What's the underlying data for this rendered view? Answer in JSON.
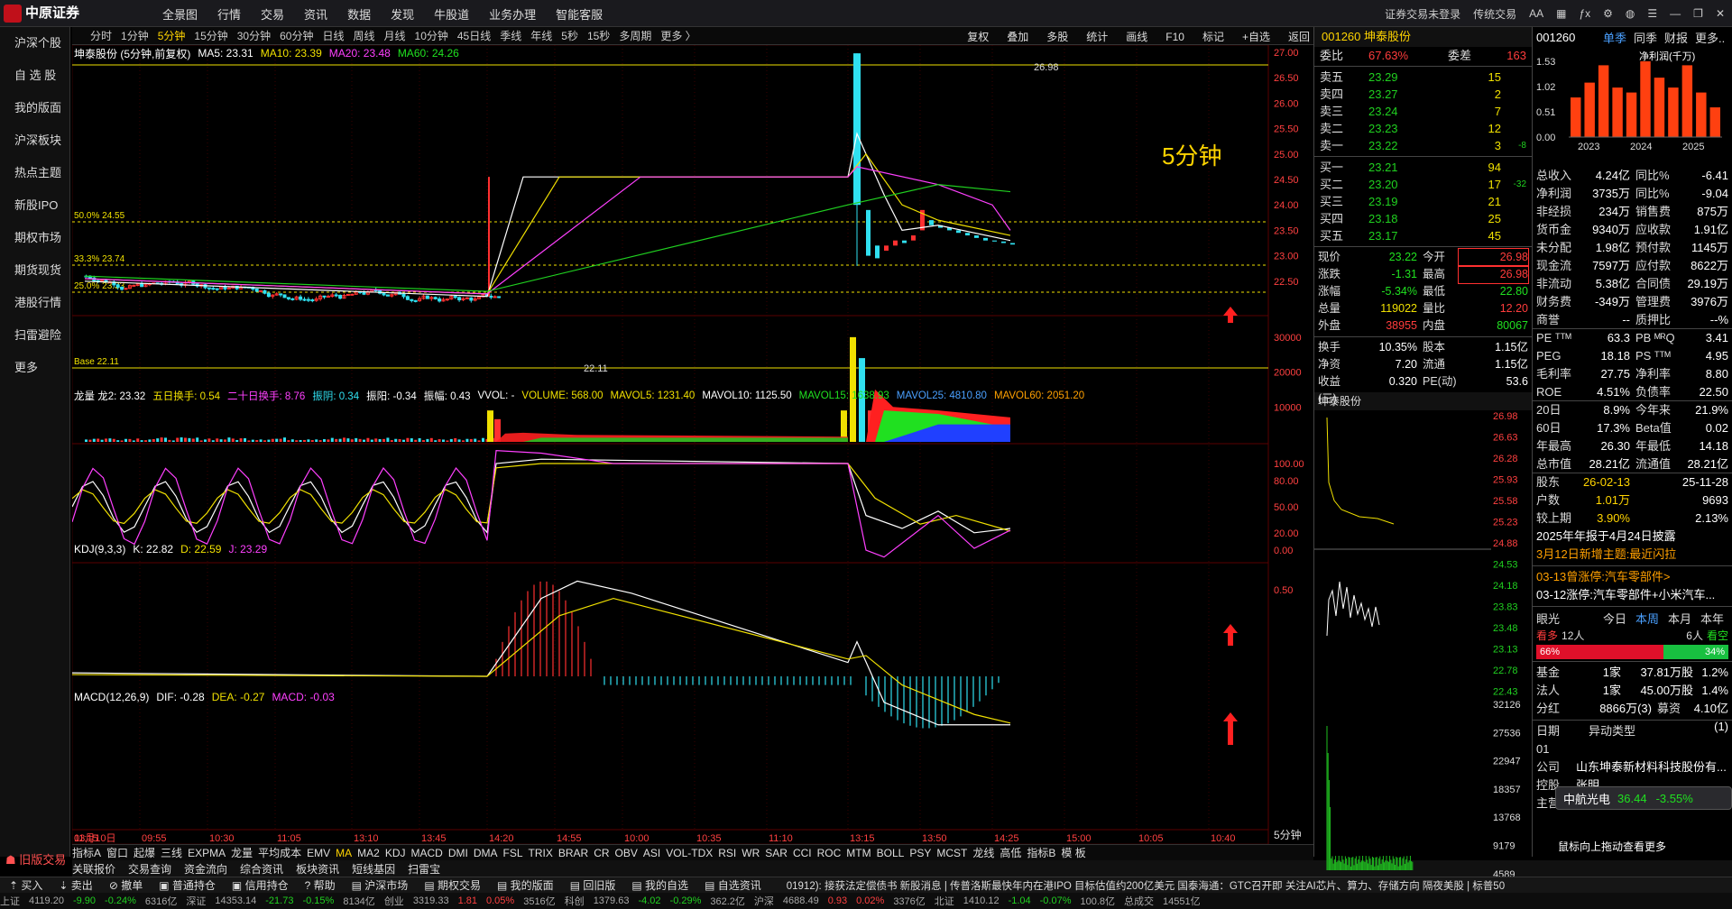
{
  "app": {
    "brand": "中原证券",
    "brand_sub": "CENTRAL CHINA SECURITIES"
  },
  "topmenu": [
    "全景图",
    "行情",
    "交易",
    "资讯",
    "数据",
    "发现",
    "牛股道",
    "业务办理",
    "智能客服"
  ],
  "topright": [
    "证券交易未登录",
    "传统交易"
  ],
  "leftnav": [
    "沪深个股",
    "自 选 股",
    "我的版面",
    "沪深板块",
    "热点主题",
    "新股IPO",
    "期权市场",
    "期货现货",
    "港股行情",
    "扫雷避险",
    "更多"
  ],
  "legacy": "旧版交易",
  "periods": [
    "分时",
    "1分钟",
    "5分钟",
    "15分钟",
    "30分钟",
    "60分钟",
    "日线",
    "周线",
    "月线",
    "10分钟",
    "45日线",
    "季线",
    "年线",
    "5秒",
    "15秒",
    "多周期",
    "更多 〉"
  ],
  "tools": [
    "复权",
    "叠加",
    "多股",
    "统计",
    "画线",
    "F10",
    "标记",
    "+自选",
    "返回"
  ],
  "chart": {
    "title": "坤泰股份 (5分钟,前复权)",
    "ma": [
      {
        "label": "MA5: 23.31",
        "color": "#ffffff"
      },
      {
        "label": "MA10: 23.39",
        "color": "#f0e000"
      },
      {
        "label": "MA20: 23.48",
        "color": "#ff40ff"
      },
      {
        "label": "MA60: 24.26",
        "color": "#20d020"
      }
    ],
    "big_label": "5分钟",
    "fib": [
      "50.0% 24.55",
      "33.3% 23.74",
      "25.0% 23.33",
      "Base 22.11"
    ],
    "high_mark": "26.98",
    "low_mark": "22.11",
    "price_axis": [
      "27.00",
      "26.50",
      "26.00",
      "25.50",
      "25.00",
      "24.50",
      "24.00",
      "23.50",
      "23.00",
      "22.50"
    ],
    "vol_legend": [
      "龙量 龙2: 23.32",
      "五日换手: 0.54",
      "二十日换手: 8.76",
      "振阴: 0.34",
      "振阳: -0.34",
      "振幅: 0.43",
      "VVOL: -",
      "VOLUME: 568.00",
      "MAVOL5: 1231.40",
      "MAVOL10: 1125.50",
      "MAVOL15: 1638.93",
      "MAVOL25: 4810.80",
      "MAVOL60: 2051.20"
    ],
    "vol_axis": [
      "30000",
      "20000",
      "10000"
    ],
    "kdj_legend": [
      "KDJ(9,3,3)",
      "K: 22.82",
      "D: 22.59",
      "J: 23.29"
    ],
    "kdj_axis": [
      "100.00",
      "80.00",
      "50.00",
      "20.00",
      "0.00"
    ],
    "macd_legend": [
      "MACD(12,26,9)",
      "DIF: -0.28",
      "DEA: -0.27",
      "MACD: -0.03"
    ],
    "macd_axis": [
      "0.50"
    ],
    "time_axis": [
      "03月10日",
      "09:55",
      "10:30",
      "11:05",
      "13:10",
      "13:45",
      "14:20",
      "14:55",
      "10:00",
      "10:35",
      "11:10",
      "13:15",
      "13:50",
      "14:25",
      "15:00",
      "10:05",
      "10:40",
      "11:15"
    ],
    "period_tag": "5分钟"
  },
  "bottomtabs": [
    "指标A",
    "窗口",
    "起爆",
    "三线",
    "EXPMA",
    "龙量",
    "平均成本",
    "EMV",
    "MA",
    "MA2",
    "KDJ",
    "MACD",
    "DMI",
    "DMA",
    "FSL",
    "TRIX",
    "BRAR",
    "CR",
    "OBV",
    "ASI",
    "VOL-TDX",
    "RSI",
    "WR",
    "SAR",
    "CCI",
    "ROC",
    "MTM",
    "BOLL",
    "PSY",
    "MCST",
    "龙线",
    "高低",
    "指标B",
    "模 板"
  ],
  "funcbar": [
    "关联报价",
    "交易查询",
    "资金流向",
    "综合资讯",
    "板块资讯",
    "短线基因",
    "扫雷宝"
  ],
  "quote": {
    "title": "001260 坤泰股份",
    "weibi": {
      "label": "委比",
      "val": "67.63%",
      "label2": "委差",
      "val2": "163"
    },
    "sells": [
      {
        "l": "卖五",
        "p": "23.29",
        "v": "15"
      },
      {
        "l": "卖四",
        "p": "23.27",
        "v": "2"
      },
      {
        "l": "卖三",
        "p": "23.24",
        "v": "7"
      },
      {
        "l": "卖二",
        "p": "23.23",
        "v": "12"
      },
      {
        "l": "卖一",
        "p": "23.22",
        "v": "3",
        "x": "-8"
      }
    ],
    "buys": [
      {
        "l": "买一",
        "p": "23.21",
        "v": "94"
      },
      {
        "l": "买二",
        "p": "23.20",
        "v": "17",
        "x": "-32"
      },
      {
        "l": "买三",
        "p": "23.19",
        "v": "21"
      },
      {
        "l": "买四",
        "p": "23.18",
        "v": "25"
      },
      {
        "l": "买五",
        "p": "23.17",
        "v": "45"
      }
    ],
    "stats": [
      {
        "a": "现价",
        "b": "23.22",
        "bc": "grn",
        "c": "今开",
        "d": "26.98",
        "dc": "red"
      },
      {
        "a": "涨跌",
        "b": "-1.31",
        "bc": "grn",
        "c": "最高",
        "d": "26.98",
        "dc": "red"
      },
      {
        "a": "涨幅",
        "b": "-5.34%",
        "bc": "grn",
        "c": "最低",
        "d": "22.80",
        "dc": "grn"
      },
      {
        "a": "总量",
        "b": "119022",
        "bc": "yel",
        "c": "量比",
        "d": "12.20",
        "dc": "red"
      },
      {
        "a": "外盘",
        "b": "38955",
        "bc": "red",
        "c": "内盘",
        "d": "80067",
        "dc": "grn"
      }
    ],
    "stats2": [
      {
        "a": "换手",
        "b": "10.35%",
        "c": "股本",
        "d": "1.15亿"
      },
      {
        "a": "净资",
        "b": "7.20",
        "c": "流通",
        "d": "1.15亿"
      },
      {
        "a": "收益(三)",
        "b": "0.320",
        "c": "PE(动)",
        "d": "53.6"
      }
    ],
    "mini_title": "坤泰股份",
    "mini_axis": [
      "26.98",
      "26.63",
      "26.28",
      "25.93",
      "25.58",
      "25.23",
      "24.88",
      "24.53",
      "24.18",
      "23.83",
      "23.48",
      "23.13",
      "22.78",
      "22.43",
      "32126",
      "27536",
      "22947",
      "18357",
      "13768",
      "9179",
      "4589"
    ]
  },
  "fin": {
    "code": "001260",
    "tabs": [
      "单季",
      "同季",
      "财报",
      "更多.."
    ],
    "chart_title": "净利润(千万)",
    "yaxis": [
      "1.53",
      "1.02",
      "0.51",
      "0.00"
    ],
    "years": [
      "2023",
      "2024",
      "2025"
    ],
    "bars": [
      0.8,
      1.1,
      1.45,
      1.0,
      0.9,
      1.53,
      1.2,
      1.0,
      1.45,
      0.9,
      0.6
    ],
    "rows": [
      {
        "a": "总收入",
        "b": "4.24亿",
        "c": "同比%",
        "d": "-6.41"
      },
      {
        "a": "净利润",
        "b": "3735万",
        "c": "同比%",
        "d": "-9.04"
      },
      {
        "a": "非经损",
        "b": "234万",
        "c": "销售费",
        "d": "875万"
      },
      {
        "a": "货币金",
        "b": "9340万",
        "c": "应收款",
        "d": "1.91亿"
      },
      {
        "a": "未分配",
        "b": "1.98亿",
        "c": "预付款",
        "d": "1145万"
      },
      {
        "a": "现金流",
        "b": "7597万",
        "c": "应付款",
        "d": "8622万"
      },
      {
        "a": "非流动",
        "b": "5.38亿",
        "c": "合同债",
        "d": "29.19万"
      },
      {
        "a": "财务费",
        "b": "-349万",
        "c": "管理费",
        "d": "3976万"
      },
      {
        "a": "商誉",
        "b": "--",
        "c": "质押比",
        "d": "--%"
      },
      {
        "a": "PE ᵀᵀᴹ",
        "b": "63.3",
        "c": "PB ᴹᴿQ",
        "d": "3.41"
      },
      {
        "a": "PEG",
        "b": "18.18",
        "c": "PS ᵀᵀᴹ",
        "d": "4.95"
      },
      {
        "a": "毛利率",
        "b": "27.75",
        "c": "净利率",
        "d": "8.80"
      },
      {
        "a": "ROE",
        "b": "4.51%",
        "c": "负债率",
        "d": "22.50"
      },
      {
        "a": "20日",
        "b": "8.9%",
        "c": "今年来",
        "d": "21.9%"
      },
      {
        "a": "60日",
        "b": "17.3%",
        "c": "Beta值",
        "d": "0.02"
      },
      {
        "a": "年最高",
        "b": "26.30",
        "c": "年最低",
        "d": "14.18"
      },
      {
        "a": "总市值",
        "b": "28.21亿",
        "c": "流通值",
        "d": "28.21亿"
      },
      {
        "a": "股东",
        "b": "26-02-13",
        "c": "",
        "d": "25-11-28"
      },
      {
        "a": "户数",
        "b": "1.01万",
        "c": "",
        "d": "9693"
      },
      {
        "a": "较上期",
        "b": "3.90%",
        "c": "",
        "d": "2.13%"
      }
    ],
    "notice1": "2025年年报于4月24日披露",
    "notice2": "3月12日新增主题:最近闪拉",
    "news1": "03-13曾涨停:汽车零部件>",
    "news2": "03-12涨停:汽车零部件+小米汽车...",
    "view": {
      "label": "眼光",
      "tabs": [
        "今日",
        "本周",
        "本月",
        "本年"
      ],
      "bull": "看多",
      "bull_n": "12人",
      "bear_n": "6人",
      "bear": "看空",
      "bull_pct": "66%",
      "bear_pct": "34%"
    },
    "holders": [
      {
        "a": "基金",
        "b": "1家",
        "c": "37.81万股",
        "d": "1.2%"
      },
      {
        "a": "法人",
        "b": "1家",
        "c": "45.00万股",
        "d": "1.4%"
      }
    ],
    "fenhong": {
      "a": "分红",
      "b": "8866万(3)",
      "c": "募资",
      "d": "4.10亿(1)"
    },
    "date_row": {
      "a": "日期",
      "b": "异动类型"
    },
    "company": {
      "a": "公司",
      "b": "山东坤泰新材料科技股份有..."
    },
    "ctrl": {
      "a": "控股",
      "b": "张明"
    },
    "main": {
      "a": "主营",
      "b": "汽车软内饰材料的研发、生..."
    },
    "popup": {
      "name": "中航光电",
      "price": "36.44",
      "chg": "-3.55%"
    },
    "drag": "鼠标向上拖动查看更多"
  },
  "taskbar": [
    "买入",
    "卖出",
    "撤单",
    "普通持仓",
    "信用持仓",
    "帮助",
    "沪深市场",
    "期权交易",
    "我的版面",
    "回旧版",
    "我的自选",
    "自选资讯"
  ],
  "ticker": "01912): 接获法定偿债书     新股消息 | 传普洛斯最快年内在港IPO 目标估值约200亿美元     国泰海通：GTC召开即 关注AI芯片、算力、存储方向     隔夜美股 | 标普50",
  "indexbar": [
    "上证",
    "4119.20",
    "-9.90",
    "-0.24%",
    "6316亿",
    "深证",
    "14353.14",
    "-21.73",
    "-0.15%",
    "8134亿",
    "创业",
    "3319.33",
    "1.81",
    "0.05%",
    "3516亿",
    "科创",
    "1379.63",
    "-4.02",
    "-0.29%",
    "362.2亿",
    "沪深",
    "4688.49",
    "0.93",
    "0.02%",
    "3376亿",
    "北证",
    "1410.12",
    "-1.04",
    "-0.07%",
    "100.8亿",
    "总成交",
    "14551亿"
  ]
}
